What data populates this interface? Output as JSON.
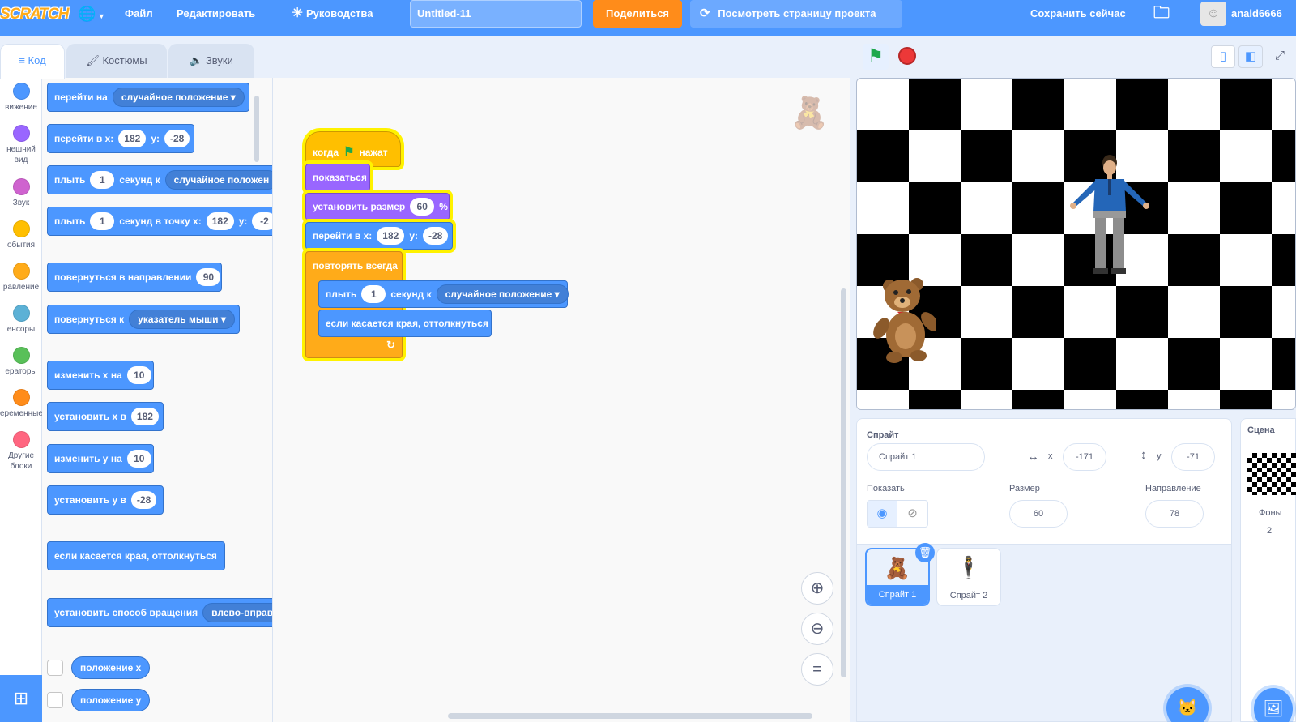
{
  "menu": {
    "logo": "SCRATCH",
    "globe_icon": "globe-icon",
    "file": "Файл",
    "edit": "Редактировать",
    "tutorials": "Руководства",
    "project_title": "Untitled-11",
    "share": "Поделиться",
    "see_project_page": "Посмотреть страницу проекта",
    "save_now": "Сохранить сейчас",
    "username": "anaid6666"
  },
  "tabs": [
    {
      "label": "Код",
      "icon": "code-icon",
      "active": true
    },
    {
      "label": "Костюмы",
      "icon": "brush-icon",
      "active": false
    },
    {
      "label": "Звуки",
      "icon": "speaker-icon",
      "active": false
    }
  ],
  "categories": [
    {
      "label": "вижение",
      "color": "#4c97ff"
    },
    {
      "label": "нешний вид",
      "color": "#9966ff"
    },
    {
      "label": "Звук",
      "color": "#cf63cf"
    },
    {
      "label": "обытия",
      "color": "#ffbf00"
    },
    {
      "label": "равление",
      "color": "#ffab19"
    },
    {
      "label": "енсоры",
      "color": "#5cb1d6"
    },
    {
      "label": "ераторы",
      "color": "#59c059"
    },
    {
      "label": "еременные",
      "color": "#ff8c1a"
    },
    {
      "label": "Другие блоки",
      "color": "#ff6680"
    }
  ],
  "palette": {
    "goto": {
      "text": "перейти на",
      "dropdown": "случайное положение"
    },
    "gotoxy": {
      "text": "перейти в x:",
      "x": "182",
      "ylabel": "y:",
      "y": "-28"
    },
    "glide_to": {
      "text": "плыть",
      "secs": "1",
      "text2": "секунд к",
      "dropdown": "случайное положен"
    },
    "glide_xy": {
      "text": "плыть",
      "secs": "1",
      "text2": "секунд в точку x:",
      "x": "182",
      "ylabel": "y:",
      "y": "-2"
    },
    "point_dir": {
      "text": "повернуться в направлении",
      "value": "90"
    },
    "point_towards": {
      "text": "повернуться к",
      "dropdown": "указатель мыши"
    },
    "change_x": {
      "text": "изменить х на",
      "value": "10"
    },
    "set_x": {
      "text": "установить х в",
      "value": "182"
    },
    "change_y": {
      "text": "изменить у на",
      "value": "10"
    },
    "set_y": {
      "text": "установить у в",
      "value": "-28"
    },
    "bounce": {
      "text": "если касается края, оттолкнуться"
    },
    "rotation": {
      "text": "установить способ вращения",
      "dropdown": "влево-вправ"
    },
    "xpos": "положение x",
    "ypos": "положение y"
  },
  "script": {
    "when_flag": {
      "pre": "когда",
      "post": "нажат"
    },
    "show": "показаться",
    "set_size": {
      "text": "установить размер",
      "value": "60",
      "unit": "%"
    },
    "goto_xy": {
      "text": "перейти в x:",
      "x": "182",
      "ylabel": "y:",
      "y": "-28"
    },
    "forever": "повторять всегда",
    "glide": {
      "text": "плыть",
      "secs": "1",
      "text2": "секунд к",
      "dropdown": "случайное положение"
    },
    "bounce": "если касается края, оттолкнуться"
  },
  "sprite_info": {
    "sprite_label": "Спрайт",
    "sprite_name": "Спрайт 1",
    "x_label": "x",
    "x": "-171",
    "y_label": "y",
    "y": "-71",
    "show_label": "Показать",
    "size_label": "Размер",
    "size": "60",
    "direction_label": "Направление",
    "direction": "78"
  },
  "sprites": [
    {
      "name": "Спрайт 1",
      "selected": true
    },
    {
      "name": "Спрайт 2",
      "selected": false
    }
  ],
  "scene": {
    "label": "Сцена",
    "backdrops_label": "Фоны",
    "backdrops_count": "2"
  }
}
